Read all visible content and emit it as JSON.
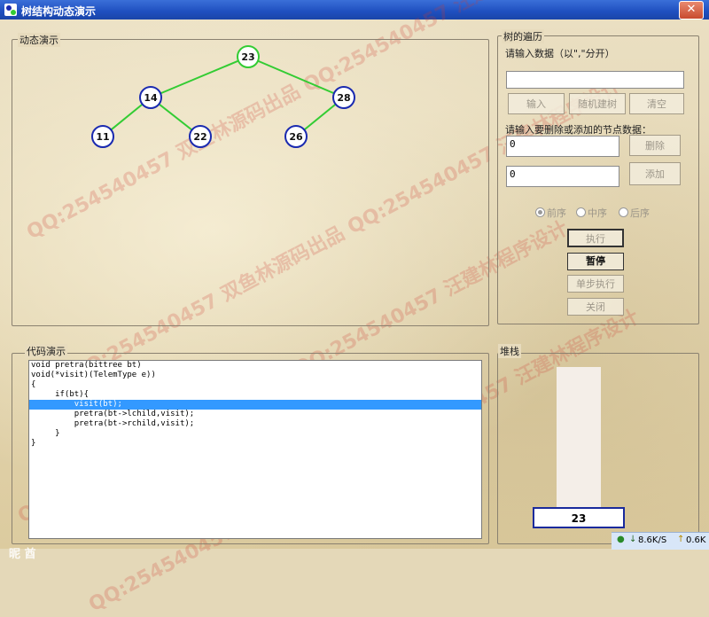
{
  "window": {
    "title": "树结构动态演示",
    "close_glyph": "✕"
  },
  "demo_group": {
    "label": "动态演示"
  },
  "tree": {
    "nodes": [
      {
        "value": "23",
        "highlight": true
      },
      {
        "value": "14",
        "highlight": false
      },
      {
        "value": "28",
        "highlight": false
      },
      {
        "value": "11",
        "highlight": false
      },
      {
        "value": "22",
        "highlight": false
      },
      {
        "value": "26",
        "highlight": false
      }
    ],
    "edge_color": "#33cc33",
    "node_border_color": "#1a2ab0",
    "highlight_border_color": "#33cc33"
  },
  "traversal_group": {
    "label": "树的遍历",
    "input_prompt": "请输入数据（以\",\"分开）",
    "data_input_value": "",
    "input_button": "输入",
    "random_build_button": "随机建树",
    "clear_button": "清空",
    "node_prompt": "请输入要删除或添加的节点数据：",
    "delete_input_value": "0",
    "delete_button": "删除",
    "add_input_value": "0",
    "add_button": "添加",
    "radios": [
      {
        "label": "前序",
        "selected": true
      },
      {
        "label": "中序",
        "selected": false
      },
      {
        "label": "后序",
        "selected": false
      }
    ],
    "execute_button": "执行",
    "pause_button": "暂停",
    "step_button": "单步执行",
    "close_button": "关闭"
  },
  "code_group": {
    "label": "代码演示",
    "lines": [
      "void pretra(bittree bt)",
      "void(*visit)(TelemType e))",
      "{",
      "     if(bt){",
      "         visit(bt);",
      "         pretra(bt->lchild,visit);",
      "         pretra(bt->rchild,visit);",
      "     }",
      "}"
    ],
    "highlighted_line": 4
  },
  "stack_group": {
    "label": "堆栈",
    "top_value": "23"
  },
  "watermark_text": "QQ:254540457 双鱼林源码出品  QQ:254540457 汪建林程序设计",
  "overlay_text": "昵 酋",
  "taskbar": {
    "down_speed": "8.6K/S",
    "up_speed": "0.6K"
  }
}
